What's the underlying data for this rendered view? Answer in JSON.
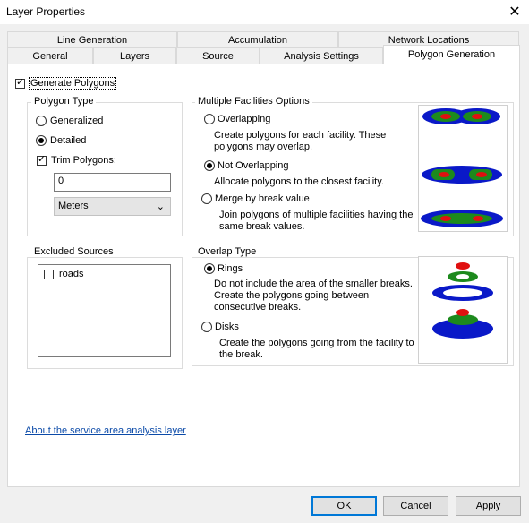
{
  "window": {
    "title": "Layer Properties",
    "close_glyph": "✕"
  },
  "tabs_back": [
    {
      "label": "Line Generation"
    },
    {
      "label": "Accumulation"
    },
    {
      "label": "Network Locations"
    }
  ],
  "tabs_front": [
    {
      "label": "General"
    },
    {
      "label": "Layers"
    },
    {
      "label": "Source"
    },
    {
      "label": "Analysis Settings"
    },
    {
      "label": "Polygon Generation"
    }
  ],
  "generate_polygons": {
    "label": "Generate Polygons",
    "checked": true
  },
  "polygon_type": {
    "title": "Polygon Type",
    "generalized": "Generalized",
    "detailed": "Detailed",
    "trim_label": "Trim Polygons:",
    "trim_value": "0",
    "units": "Meters"
  },
  "multiple_facilities": {
    "title": "Multiple Facilities Options",
    "overlapping": "Overlapping",
    "overlapping_desc": "Create polygons for each facility. These polygons may overlap.",
    "not_overlapping": "Not Overlapping",
    "not_overlapping_desc": "Allocate polygons to the closest facility.",
    "merge": "Merge by break value",
    "merge_desc": "Join polygons of multiple facilities having the same break values."
  },
  "excluded_sources": {
    "title": "Excluded Sources",
    "items": [
      {
        "label": "roads",
        "checked": false
      }
    ]
  },
  "overlap_type": {
    "title": "Overlap Type",
    "rings": "Rings",
    "rings_desc": "Do not include the area of the smaller breaks. Create the polygons going between consecutive breaks.",
    "disks": "Disks",
    "disks_desc": "Create the polygons going from the facility to the break."
  },
  "about_link": "About the service area analysis layer",
  "buttons": {
    "ok": "OK",
    "cancel": "Cancel",
    "apply": "Apply"
  },
  "colors": {
    "blue": "#0a19c8",
    "green": "#1d8a1d",
    "red": "#e01010",
    "link": "#0b4aa8"
  }
}
